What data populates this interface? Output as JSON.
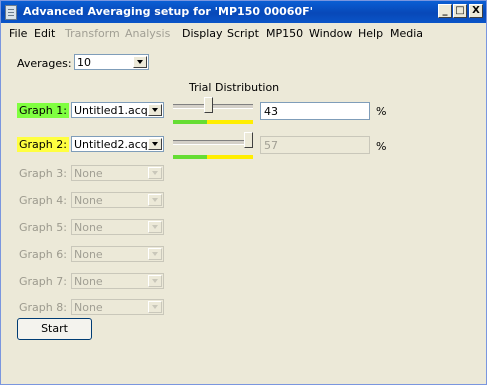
{
  "window": {
    "title": "Advanced Averaging setup for 'MP150 00060F'",
    "min_label": "_",
    "max_label": "□",
    "close_label": "X"
  },
  "menubar": {
    "items": [
      {
        "label": "File",
        "enabled": true
      },
      {
        "label": "Edit",
        "enabled": true
      },
      {
        "label": "Transform",
        "enabled": false
      },
      {
        "label": "Analysis",
        "enabled": false
      },
      {
        "label": "Display",
        "enabled": true
      },
      {
        "label": "Script",
        "enabled": true
      },
      {
        "label": "MP150",
        "enabled": true
      },
      {
        "label": "Window",
        "enabled": true
      },
      {
        "label": "Help",
        "enabled": true
      },
      {
        "label": "Media",
        "enabled": true
      }
    ]
  },
  "averages": {
    "label": "Averages:",
    "value": "10"
  },
  "trial_distribution": {
    "label": "Trial Distribution"
  },
  "graphs": [
    {
      "label": "Graph 1:",
      "file": "Untitled1.acq",
      "enabled": true,
      "highlight": "#80ff40",
      "percent": "43",
      "unit": "%",
      "slider_fraction": 0.43
    },
    {
      "label": "Graph 2:",
      "file": "Untitled2.acq",
      "enabled": true,
      "highlight": "#ffff40",
      "percent": "57",
      "unit": "%",
      "slider_fraction": 1.0
    },
    {
      "label": "Graph 3:",
      "file": "None",
      "enabled": false
    },
    {
      "label": "Graph 4:",
      "file": "None",
      "enabled": false
    },
    {
      "label": "Graph 5:",
      "file": "None",
      "enabled": false
    },
    {
      "label": "Graph 6:",
      "file": "None",
      "enabled": false
    },
    {
      "label": "Graph 7:",
      "file": "None",
      "enabled": false
    },
    {
      "label": "Graph 8:",
      "file": "None",
      "enabled": false
    }
  ],
  "distribution_colors": {
    "green": "#66dd33",
    "yellow": "#ffee00"
  },
  "start_button": {
    "label": "Start"
  }
}
